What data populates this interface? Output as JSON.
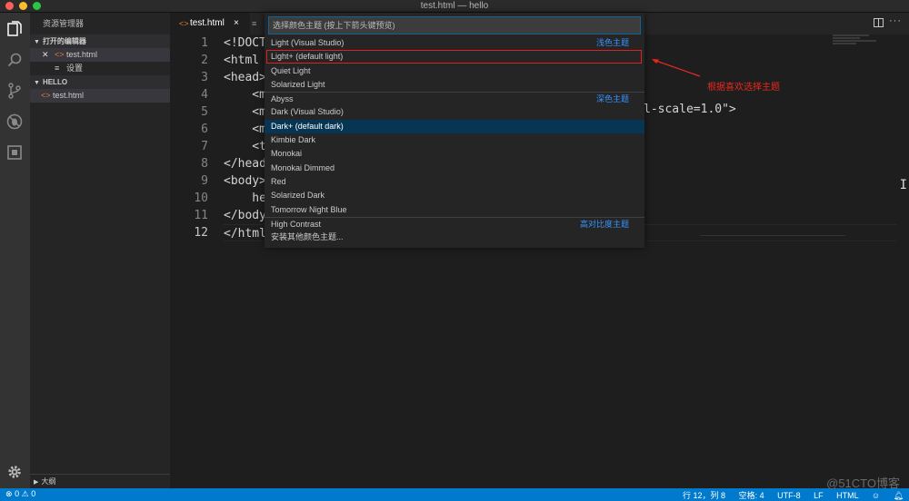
{
  "window": {
    "title": "test.html — hello"
  },
  "sidebar": {
    "header": "资源管理器",
    "open_editors": {
      "label": "打开的编辑器",
      "items": [
        "test.html",
        "设置"
      ]
    },
    "project": {
      "label": "HELLO",
      "items": [
        "test.html"
      ]
    },
    "outline_label": "大纲"
  },
  "tab": {
    "label": "test.html",
    "close": "×"
  },
  "editor": {
    "line_numbers": [
      "1",
      "2",
      "3",
      "4",
      "5",
      "6",
      "7",
      "8",
      "9",
      "10",
      "11",
      "12"
    ],
    "lines": [
      "<!DOCT",
      "<html",
      "<head>",
      "    <m",
      "    <m",
      "    <m",
      "    <t",
      "</head",
      "<body>",
      "    he",
      "</body",
      "</html"
    ],
    "overflow_text": "l-scale=1.0\">"
  },
  "palette": {
    "placeholder": "选择颜色主题 (按上下箭头键预览)",
    "items": [
      {
        "label": "Light (Visual Studio)",
        "group": "浅色主题"
      },
      {
        "label": "Light+ (default light)",
        "group": ""
      },
      {
        "label": "Quiet Light",
        "group": ""
      },
      {
        "label": "Solarized Light",
        "group": ""
      },
      {
        "label": "Abyss",
        "group": "深色主题"
      },
      {
        "label": "Dark (Visual Studio)",
        "group": ""
      },
      {
        "label": "Dark+ (default dark)",
        "group": ""
      },
      {
        "label": "Kimbie Dark",
        "group": ""
      },
      {
        "label": "Monokai",
        "group": ""
      },
      {
        "label": "Monokai Dimmed",
        "group": ""
      },
      {
        "label": "Red",
        "group": ""
      },
      {
        "label": "Solarized Dark",
        "group": ""
      },
      {
        "label": "Tomorrow Night Blue",
        "group": ""
      },
      {
        "label": "High Contrast",
        "group": "高对比度主题"
      },
      {
        "label": "安装其他颜色主题...",
        "group": ""
      }
    ]
  },
  "annotation": {
    "text": "根据喜欢选择主题"
  },
  "status": {
    "errors": "0",
    "warnings": "0",
    "position": "行 12，列 8",
    "spaces": "空格: 4",
    "encoding": "UTF-8",
    "eol": "LF",
    "language": "HTML"
  },
  "watermark": "@51CTO博客",
  "colors": {
    "accent": "#007acc",
    "selection": "#073655",
    "annotation": "#e8281f"
  }
}
